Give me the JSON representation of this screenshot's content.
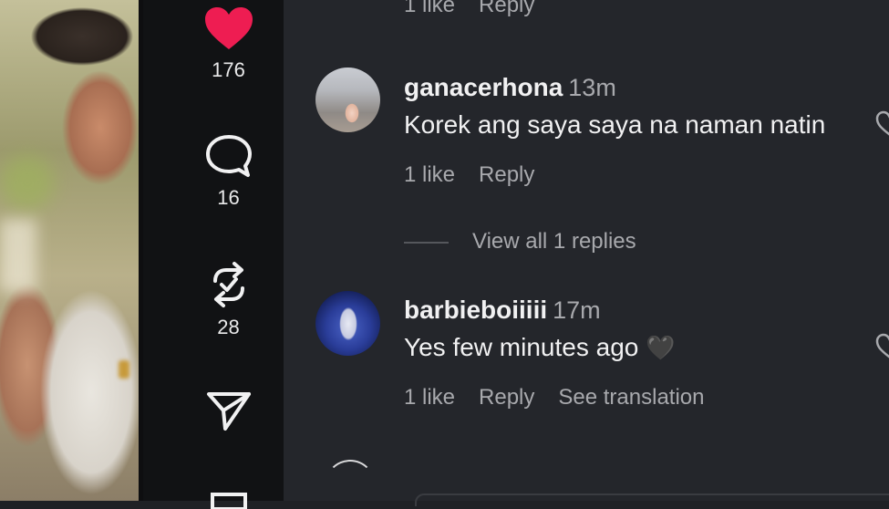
{
  "rail": {
    "likes": "176",
    "comments": "16",
    "reposts": "28"
  },
  "comments": [
    {
      "meta_likes": "1 like",
      "meta_reply": "Reply"
    },
    {
      "username": "ganacerhona",
      "time": "13m",
      "text": "Korek ang saya saya na naman natin",
      "likes": "1 like",
      "reply": "Reply",
      "view_replies": "View all 1 replies"
    },
    {
      "username": "barbieboiiiii",
      "time": "17m",
      "text": "Yes few minutes ago",
      "emoji": "🖤",
      "likes": "1 like",
      "reply": "Reply",
      "translate": "See translation"
    }
  ],
  "colors": {
    "like_red": "#ee1d52",
    "panel_bg": "#24262b",
    "rail_bg": "#111214"
  },
  "icons": [
    "heart-icon",
    "comment-icon",
    "repost-icon",
    "share-icon",
    "heart-outline-icon"
  ]
}
